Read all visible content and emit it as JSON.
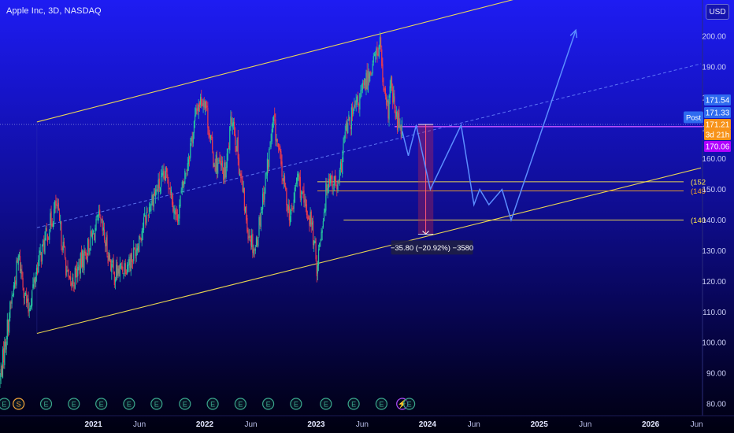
{
  "header": {
    "symbol_title": "Apple Inc, 3D, NASDAQ",
    "currency": "USD"
  },
  "colors": {
    "bull": "#26c6a0",
    "bear": "#ef3b4c",
    "channel": "#ffe94d",
    "midline": "#6b86ff",
    "projection": "#5b8dff",
    "post_badge": "#2e6bf0",
    "last_badge": "#f7931a",
    "target_badge": "#b000ff"
  },
  "chart_data": {
    "type": "candlestick",
    "symbol": "Apple Inc",
    "interval": "3D",
    "exchange": "NASDAQ",
    "currency": "USD",
    "y_range": [
      78,
      214
    ],
    "y_ticks": [
      80,
      90,
      100,
      110,
      120,
      130,
      140,
      150,
      160,
      170,
      180,
      190,
      200
    ],
    "y_tick_labels": [
      "80.00",
      "90.00",
      "100.00",
      "110.00",
      "120.00",
      "130.00",
      "140.00",
      "150.00",
      "160.00",
      "170.00",
      "180.00",
      "190.00",
      "200.00"
    ],
    "x_ticks": [
      {
        "date": "2021-01-01",
        "label": "2021"
      },
      {
        "date": "2021-06-01",
        "label": "Jun"
      },
      {
        "date": "2022-01-01",
        "label": "2022"
      },
      {
        "date": "2022-06-01",
        "label": "Jun"
      },
      {
        "date": "2023-01-01",
        "label": "2023"
      },
      {
        "date": "2023-06-01",
        "label": "Jun"
      },
      {
        "date": "2024-01-01",
        "label": "2024"
      },
      {
        "date": "2024-06-01",
        "label": "Jun"
      },
      {
        "date": "2025-01-01",
        "label": "2025"
      },
      {
        "date": "2025-06-01",
        "label": "Jun"
      },
      {
        "date": "2026-01-01",
        "label": "2026"
      },
      {
        "date": "2026-06-01",
        "label": "Jun"
      }
    ],
    "x_range": [
      "2020-03-01",
      "2026-06-20"
    ],
    "price_path": [
      [
        "2020-03-01",
        88
      ],
      [
        "2020-03-25",
        105
      ],
      [
        "2020-05-01",
        128
      ],
      [
        "2020-06-01",
        110
      ],
      [
        "2020-07-01",
        125
      ],
      [
        "2020-09-01",
        145
      ],
      [
        "2020-10-15",
        118
      ],
      [
        "2020-12-01",
        128
      ],
      [
        "2021-01-20",
        140
      ],
      [
        "2021-03-10",
        122
      ],
      [
        "2021-05-10",
        128
      ],
      [
        "2021-07-15",
        148
      ],
      [
        "2021-09-01",
        155
      ],
      [
        "2021-10-01",
        140
      ],
      [
        "2021-12-10",
        178
      ],
      [
        "2022-01-01",
        180
      ],
      [
        "2022-01-28",
        160
      ],
      [
        "2022-03-10",
        155
      ],
      [
        "2022-04-01",
        175
      ],
      [
        "2022-05-20",
        138
      ],
      [
        "2022-06-15",
        130
      ],
      [
        "2022-08-15",
        172
      ],
      [
        "2022-09-20",
        150
      ],
      [
        "2022-10-10",
        140
      ],
      [
        "2022-11-01",
        155
      ],
      [
        "2022-11-20",
        145
      ],
      [
        "2022-12-15",
        140
      ],
      [
        "2023-01-03",
        125
      ],
      [
        "2023-02-10",
        155
      ],
      [
        "2023-03-15",
        150
      ],
      [
        "2023-04-05",
        168
      ],
      [
        "2023-05-25",
        180
      ],
      [
        "2023-07-31",
        198
      ],
      [
        "2023-08-10",
        180
      ],
      [
        "2023-08-25",
        175
      ],
      [
        "2023-09-01",
        185
      ],
      [
        "2023-09-20",
        173
      ],
      [
        "2023-10-10",
        171
      ]
    ],
    "annotations": {
      "channel_upper": {
        "from": [
          "2020-06-30",
          172
        ],
        "to": [
          "2025-06-01",
          218
        ]
      },
      "channel_lower": {
        "from": [
          "2020-06-30",
          103
        ],
        "to": [
          "2026-06-15",
          157
        ]
      },
      "channel_mid": {
        "from": [
          "2020-06-30",
          137.5
        ],
        "to": [
          "2026-06-15",
          191
        ]
      },
      "current_level": 171.21,
      "support_lines": [
        {
          "value": 152.5,
          "label": "(152",
          "color": "#ffe94d"
        },
        {
          "value": 149.5,
          "label": "(149",
          "color": "#f5a623"
        },
        {
          "value": 140,
          "label": "(140",
          "color": "#ffe94d"
        }
      ],
      "measure": {
        "from_date": "2023-12-01",
        "to_date": "2024-01-20",
        "from_value": 171.2,
        "to_value": 135.4,
        "label": "−35.80 (−20.92%) −3580"
      },
      "projection_path": [
        [
          "2023-10-10",
          169
        ],
        [
          "2023-10-30",
          161
        ],
        [
          "2023-11-25",
          171
        ],
        [
          "2024-01-10",
          150
        ],
        [
          "2024-04-20",
          171
        ],
        [
          "2024-06-01",
          145
        ],
        [
          "2024-06-20",
          150
        ],
        [
          "2024-07-20",
          145
        ],
        [
          "2024-09-01",
          150
        ],
        [
          "2024-10-01",
          140
        ],
        [
          "2025-05-01",
          202
        ]
      ],
      "post_label": "Post"
    },
    "price_badges": [
      {
        "value": 171.54,
        "label": "171.54",
        "color": "#2e6bf0"
      },
      {
        "value": 171.33,
        "label": "171.33",
        "color": "#2e6bf0"
      },
      {
        "value": 171.21,
        "label": "171.21",
        "color": "#f7931a"
      },
      {
        "value": 167.3,
        "label": "3d 21h",
        "color": "#f7931a"
      },
      {
        "value": 170.06,
        "label": "170.06",
        "color": "#b000ff"
      }
    ],
    "events": [
      {
        "date": "2020-03-15",
        "type": "E"
      },
      {
        "date": "2020-05-01",
        "type": "S"
      },
      {
        "date": "2020-07-30",
        "type": "E"
      },
      {
        "date": "2020-10-29",
        "type": "E"
      },
      {
        "date": "2021-01-27",
        "type": "E"
      },
      {
        "date": "2021-04-28",
        "type": "E"
      },
      {
        "date": "2021-07-27",
        "type": "E"
      },
      {
        "date": "2021-10-28",
        "type": "E"
      },
      {
        "date": "2022-01-27",
        "type": "E"
      },
      {
        "date": "2022-04-28",
        "type": "E"
      },
      {
        "date": "2022-07-28",
        "type": "E"
      },
      {
        "date": "2022-10-27",
        "type": "E"
      },
      {
        "date": "2023-02-02",
        "type": "E"
      },
      {
        "date": "2023-05-04",
        "type": "E"
      },
      {
        "date": "2023-08-03",
        "type": "E"
      },
      {
        "date": "2023-10-10",
        "type": "flash"
      },
      {
        "date": "2023-11-02",
        "type": "E"
      }
    ]
  }
}
